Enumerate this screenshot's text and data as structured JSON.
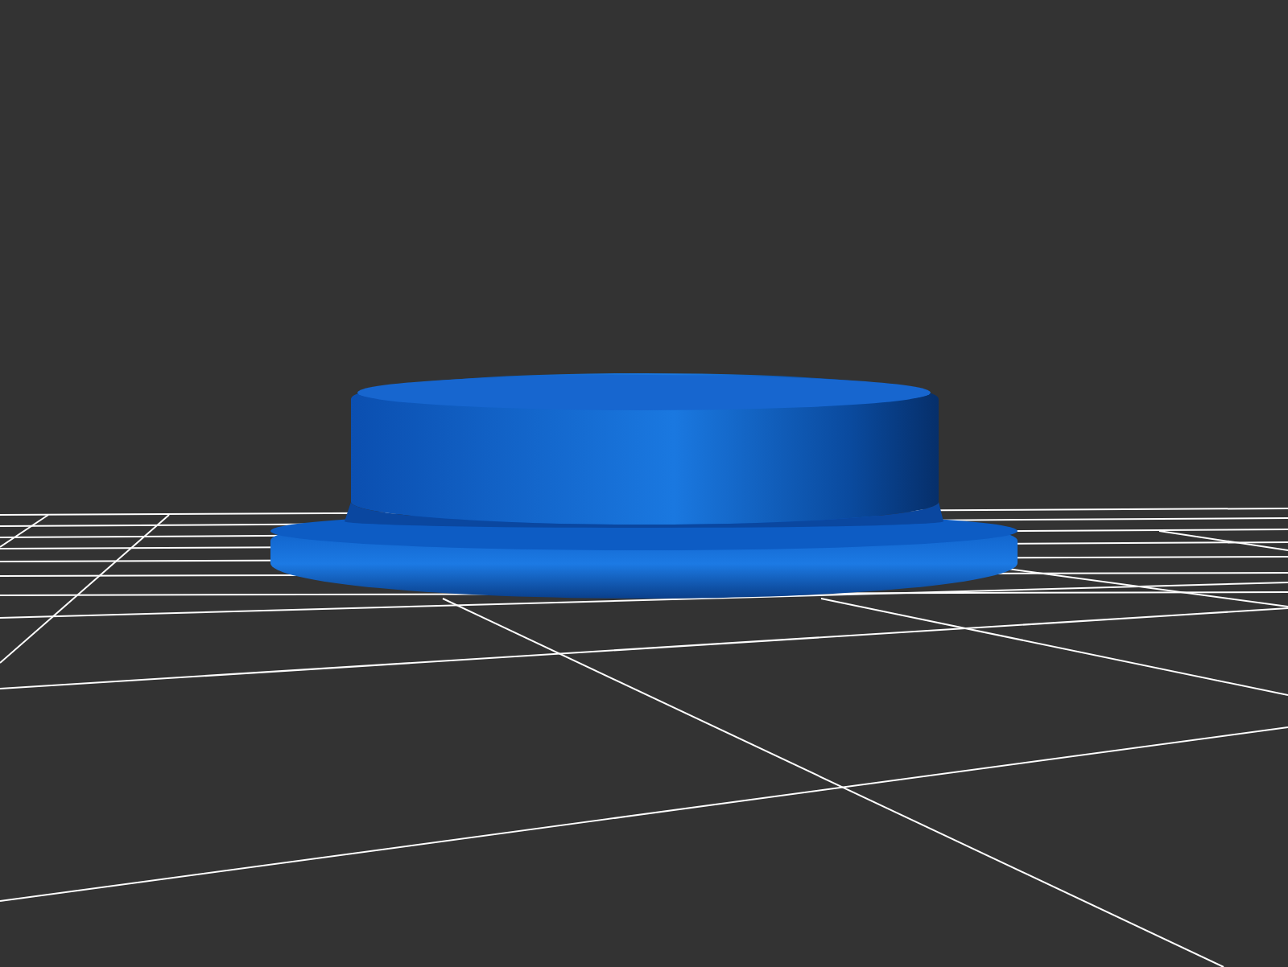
{
  "viewport": {
    "kind": "render-3d",
    "floor": {
      "kind": "grid"
    },
    "model": {
      "kind": "stepped-cylinder"
    }
  }
}
